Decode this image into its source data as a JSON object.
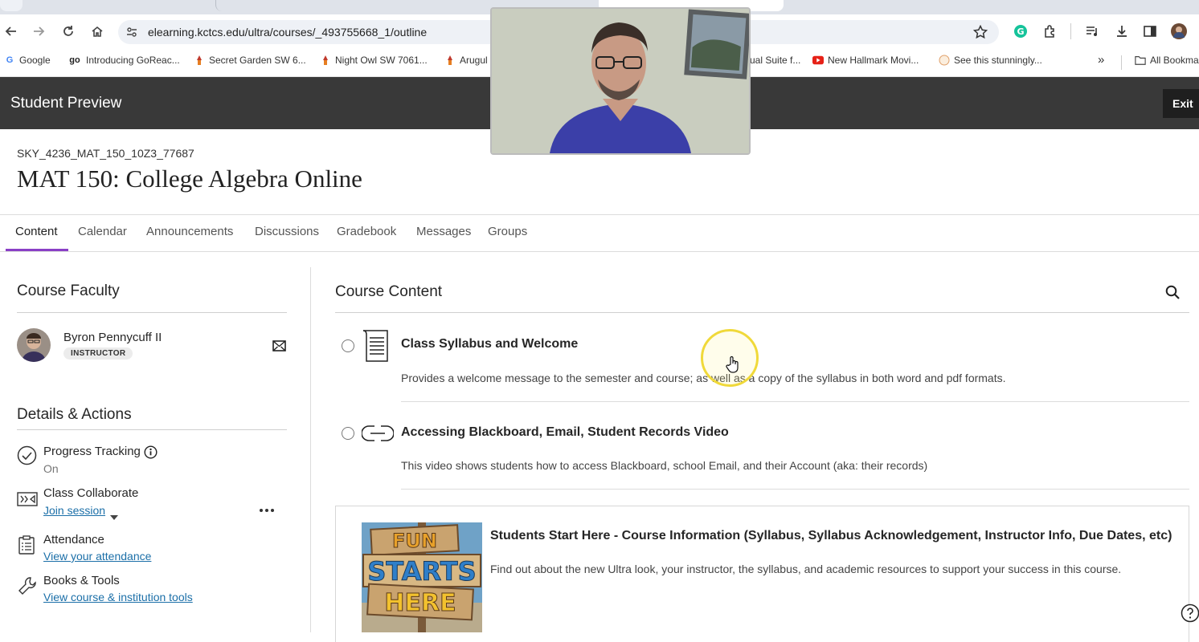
{
  "browser": {
    "url": "elearning.kctcs.edu/ultra/courses/_493755668_1/outline",
    "bookmarks": [
      {
        "label": "Google",
        "icon": "google-icon"
      },
      {
        "label": "Introducing GoReac...",
        "icon": "goreact-icon"
      },
      {
        "label": "Secret Garden SW 6...",
        "icon": "paint-icon"
      },
      {
        "label": "Night Owl SW 7061...",
        "icon": "paint-icon"
      },
      {
        "label": "Arugul",
        "icon": "paint-icon"
      },
      {
        "label": "ual Suite f...",
        "icon": ""
      },
      {
        "label": "New Hallmark Movi...",
        "icon": "youtube-icon"
      },
      {
        "label": "See this stunningly...",
        "icon": "site-icon"
      }
    ],
    "all_bookmarks_label": "All Bookma"
  },
  "preview": {
    "title": "Student Preview",
    "exit_label": "Exit"
  },
  "course": {
    "id": "SKY_4236_MAT_150_10Z3_77687",
    "title": "MAT 150: College Algebra Online"
  },
  "tabs": [
    "Content",
    "Calendar",
    "Announcements",
    "Discussions",
    "Gradebook",
    "Messages",
    "Groups"
  ],
  "faculty": {
    "heading": "Course Faculty",
    "name": "Byron Pennycuff II",
    "role": "INSTRUCTOR"
  },
  "details": {
    "heading": "Details & Actions",
    "progress_title": "Progress Tracking",
    "progress_value": "On",
    "collab_title": "Class Collaborate",
    "collab_link": "Join session",
    "attendance_title": "Attendance",
    "attendance_link": "View your attendance",
    "books_title": "Books & Tools",
    "books_link": "View course & institution tools"
  },
  "content": {
    "heading": "Course Content",
    "items": [
      {
        "title": "Class Syllabus and Welcome",
        "desc": "Provides a welcome message to the semester and course; as well as a copy of the syllabus in both word and pdf formats."
      },
      {
        "title": "Accessing Blackboard, Email, Student Records Video",
        "desc": "This video shows students how to access Blackboard, school Email, and their Account (aka: their records)"
      }
    ],
    "card": {
      "title": "Students Start Here - Course Information (Syllabus, Syllabus Acknowledgement, Instructor Info, Due Dates, etc)",
      "desc": "Find out about the new Ultra look, your instructor, the syllabus, and academic resources to support your success in this course.",
      "image_text": [
        "FUN",
        "STARTS",
        "HERE"
      ]
    }
  },
  "colors": {
    "accent": "#8a3fc6",
    "link": "#1b6fa8",
    "preview_bar": "#393939",
    "cursor_highlight": "#f5e04a"
  }
}
